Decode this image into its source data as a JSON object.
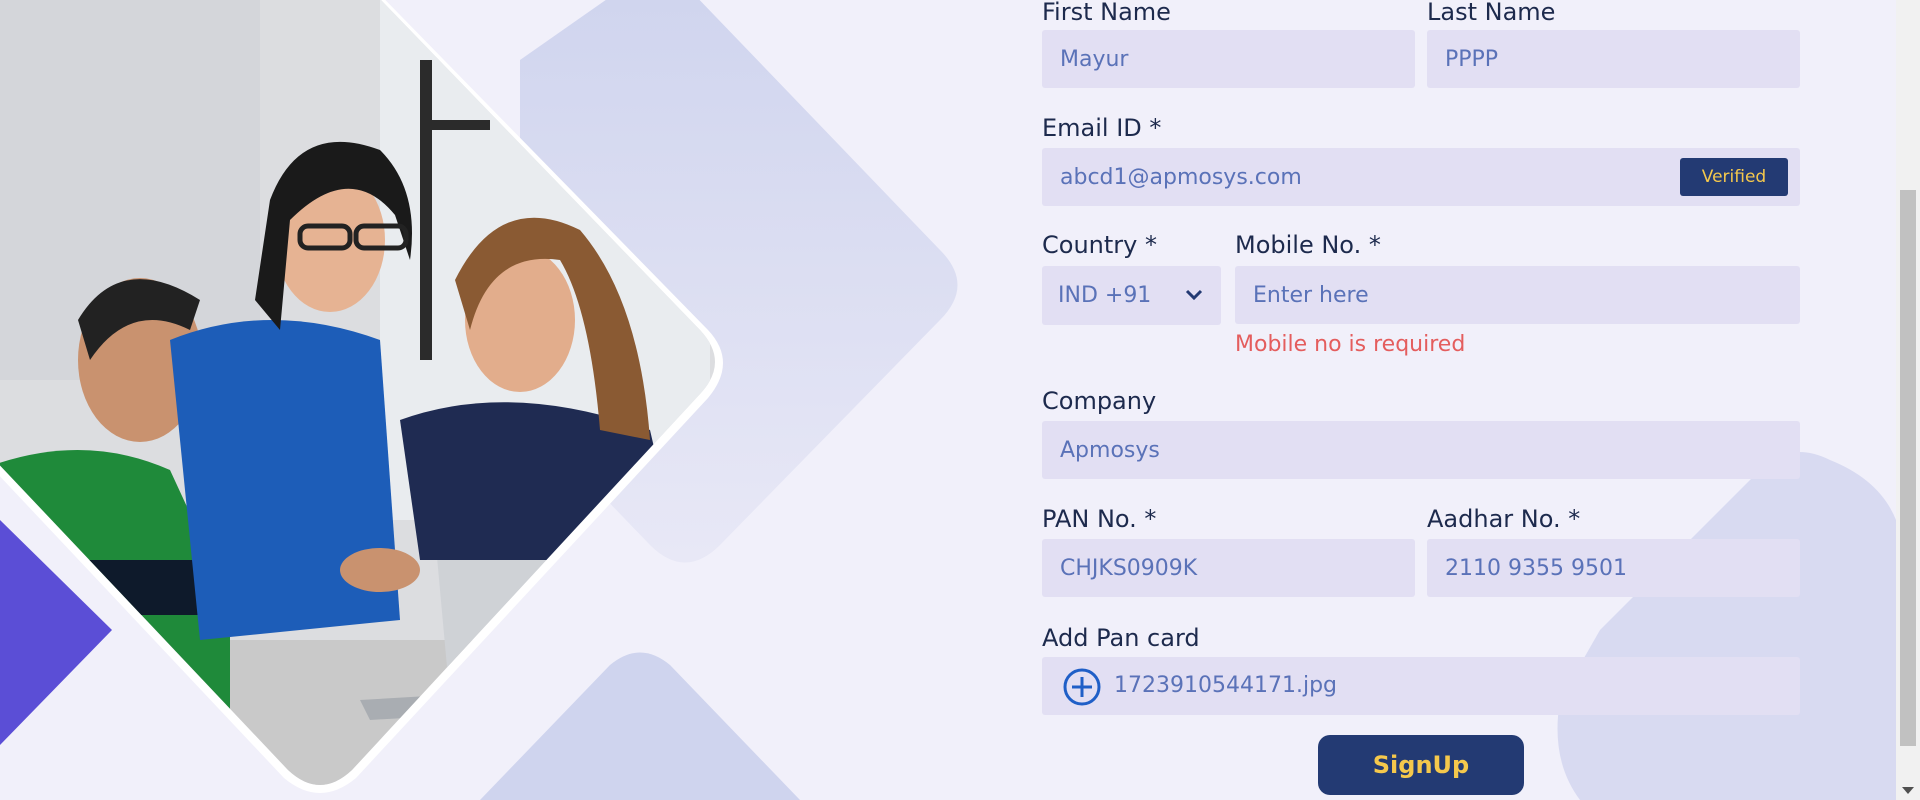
{
  "form": {
    "first_name": {
      "label": "First Name",
      "value": "Mayur"
    },
    "last_name": {
      "label": "Last Name",
      "value": "PPPP"
    },
    "email": {
      "label": "Email ID *",
      "value": "abcd1@apmosys.com",
      "badge": "Verified"
    },
    "country": {
      "label": "Country *",
      "value": "IND +91"
    },
    "mobile": {
      "label": "Mobile No. *",
      "placeholder": "Enter here",
      "error": "Mobile no is required"
    },
    "company": {
      "label": "Company",
      "value": "Apmosys"
    },
    "pan": {
      "label": "PAN No. *",
      "value": "CHJKS0909K"
    },
    "aadhar": {
      "label": "Aadhar No. *",
      "value": "2110 9355 9501"
    },
    "pan_card": {
      "label": "Add Pan card",
      "file_name": "1723910544171.jpg"
    },
    "submit_label": "SignUp"
  },
  "icons": {
    "add": "plus-circle-icon",
    "dropdown": "chevron-down-icon"
  },
  "colors": {
    "background": "#f1f0fa",
    "input_bg": "#e2dff3",
    "input_text": "#5a72b8",
    "primary": "#233a73",
    "accent_text": "#f5c84c",
    "error": "#e45d5d",
    "purple": "#6b5be0"
  }
}
